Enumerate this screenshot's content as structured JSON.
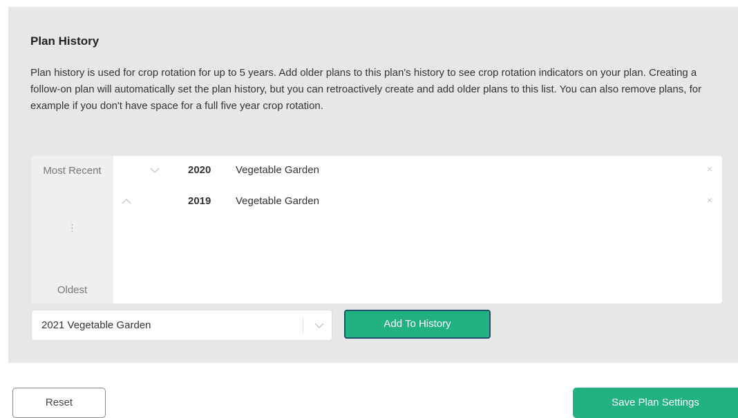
{
  "plan_history": {
    "title": "Plan History",
    "description": "Plan history is used for crop rotation for up to 5 years. Add older plans to this plan's history to see crop rotation indicators on your plan. Creating a follow-on plan will automatically set the plan history, but you can retroactively create and add older plans to this list. You can also remove plans, for example if you don't have space for a full five year crop rotation.",
    "side_labels": {
      "top": "Most Recent",
      "dots": "⋮",
      "bottom": "Oldest"
    },
    "rows": [
      {
        "year": "2020",
        "name": "Vegetable Garden",
        "arrow_icon": "chevron-down-icon",
        "remove_icon": "close-icon"
      },
      {
        "year": "2019",
        "name": "Vegetable Garden",
        "arrow_icon": "chevron-up-icon",
        "remove_icon": "close-icon"
      }
    ],
    "plan_select": {
      "value": "2021 Vegetable Garden"
    },
    "add_button_label": "Add To History"
  },
  "footer": {
    "reset_label": "Reset",
    "save_label": "Save Plan Settings"
  },
  "colors": {
    "accent": "#22b282",
    "panel_bg": "#e7e7e7",
    "focus_border": "#20506c"
  }
}
